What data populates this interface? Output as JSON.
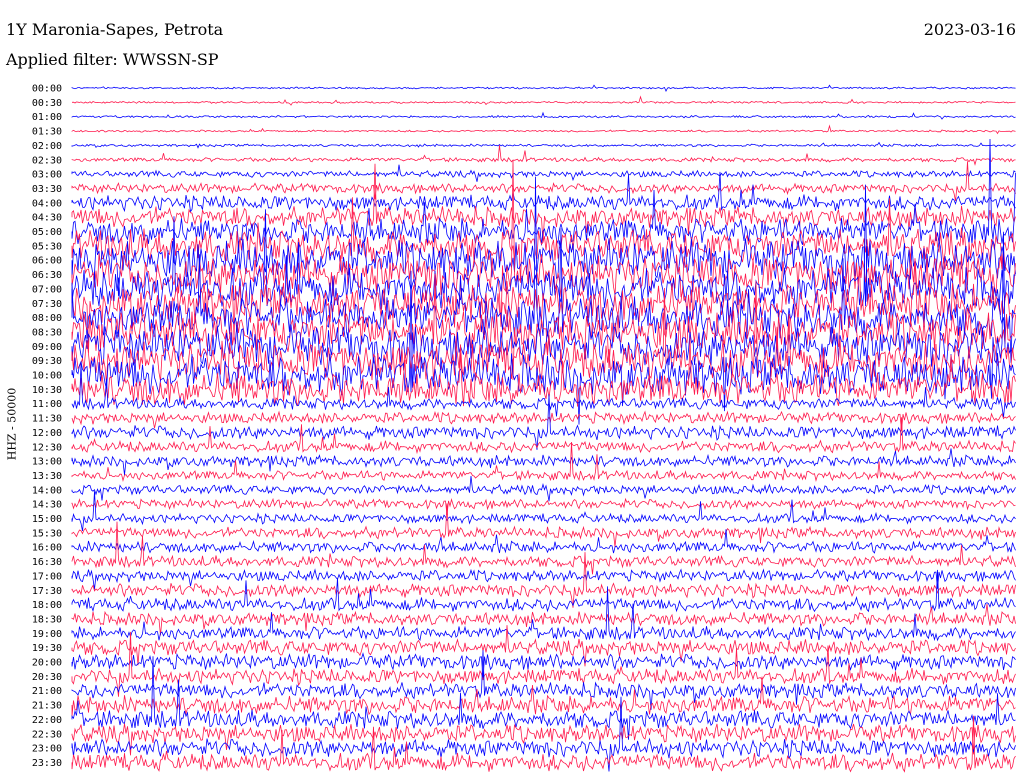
{
  "header": {
    "station": "1Y Maronia-Sapes, Petrota",
    "date": "2023-03-16",
    "filter": "Applied filter: WWSSN-SP"
  },
  "colors": {
    "trace_a": "#0000ff",
    "trace_b": "#ff1a4d"
  },
  "chart_data": {
    "type": "line",
    "title": "1Y Maronia-Sapes, Petrota",
    "subtitle": "Applied filter: WWSSN-SP",
    "ylabel": "HHZ - 50000",
    "xlabel": "",
    "y_tick_labels": [
      "00:00",
      "00:30",
      "01:00",
      "01:30",
      "02:00",
      "02:30",
      "03:00",
      "03:30",
      "04:00",
      "04:30",
      "05:00",
      "05:30",
      "06:00",
      "06:30",
      "07:00",
      "07:30",
      "08:00",
      "08:30",
      "09:00",
      "09:30",
      "10:00",
      "10:30",
      "11:00",
      "11:30",
      "12:00",
      "12:30",
      "13:00",
      "13:30",
      "14:00",
      "14:30",
      "15:00",
      "15:30",
      "16:00",
      "16:30",
      "17:00",
      "17:30",
      "18:00",
      "18:30",
      "19:00",
      "19:30",
      "20:00",
      "20:30",
      "21:00",
      "21:30",
      "22:00",
      "22:30",
      "23:00",
      "23:30"
    ],
    "series_colors": [
      "#0000ff",
      "#ff1a4d"
    ],
    "trace_activity": [
      0.05,
      0.08,
      0.1,
      0.08,
      0.15,
      0.25,
      0.35,
      0.45,
      0.6,
      0.7,
      0.8,
      0.9,
      1.0,
      1.0,
      1.0,
      1.0,
      1.0,
      1.0,
      1.0,
      1.0,
      1.0,
      0.9,
      0.5,
      0.5,
      0.55,
      0.5,
      0.5,
      0.45,
      0.45,
      0.45,
      0.45,
      0.5,
      0.5,
      0.5,
      0.5,
      0.55,
      0.55,
      0.55,
      0.55,
      0.6,
      0.6,
      0.6,
      0.6,
      0.65,
      0.65,
      0.65,
      0.65,
      0.65
    ],
    "grid": false
  }
}
